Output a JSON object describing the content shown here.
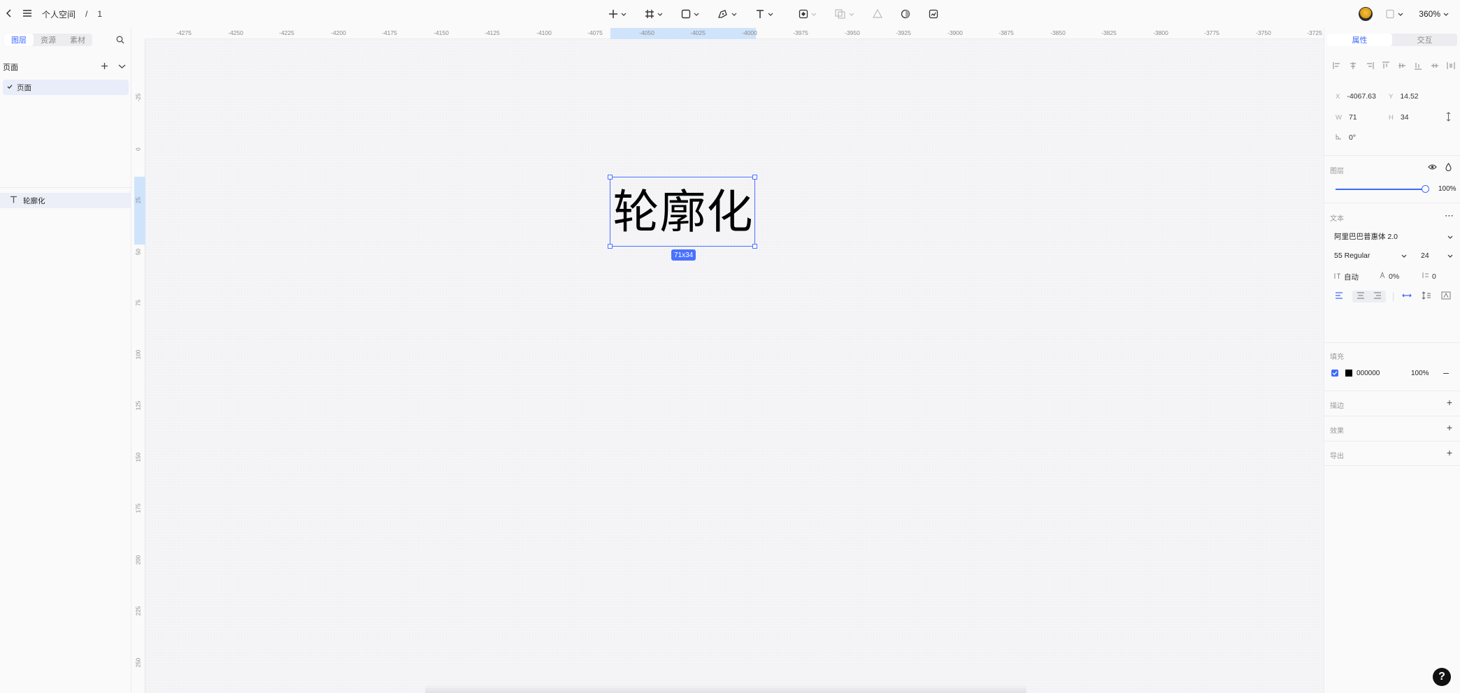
{
  "topbar": {
    "breadcrumb_space": "个人空间",
    "breadcrumb_sep": "/",
    "breadcrumb_file": "1",
    "zoom": "360%"
  },
  "left_panel": {
    "tabs": [
      "图层",
      "资源",
      "素材"
    ],
    "active_tab": "图层",
    "pages_title": "页面",
    "pages": [
      {
        "label": "页面",
        "selected": true
      }
    ],
    "layers": [
      {
        "label": "轮廓化",
        "type": "text-icon"
      }
    ]
  },
  "rulers": {
    "h_ticks": [
      "-4275",
      "-4250",
      "-4225",
      "-4200",
      "-4175",
      "-4150",
      "-4125",
      "-4100",
      "-4075",
      "-4050",
      "-4025",
      "-4000",
      "-3975",
      "-3950",
      "-3925",
      "-3900",
      "-3875",
      "-3850",
      "-3825",
      "-3800",
      "-3775",
      "-3750",
      "-3725"
    ],
    "v_ticks": [
      "-25",
      "0",
      "25",
      "50",
      "75",
      "100",
      "125",
      "150",
      "175",
      "200",
      "225",
      "250"
    ]
  },
  "canvas": {
    "text_content": "轮廓化",
    "size_badge": "71x34"
  },
  "right_panel": {
    "tabs": [
      "属性",
      "交互"
    ],
    "active_tab": "属性",
    "x_label": "X",
    "x_value": "-4067.63",
    "y_label": "Y",
    "y_value": "14.52",
    "w_label": "W",
    "w_value": "71",
    "h_label": "H",
    "h_value": "34",
    "rotation": "0°",
    "layer_title": "图层",
    "opacity": "100%",
    "opacity_fraction": 1.0,
    "text_title": "文本",
    "font_family": "阿里巴巴普惠体 2.0",
    "font_weight": "55 Regular",
    "font_size": "24",
    "line_height": "自动",
    "letter_spacing": "0%",
    "paragraph_spacing": "0",
    "fill_title": "填充",
    "fill_hex": "000000",
    "fill_color": "#000000",
    "fill_opacity": "100%",
    "stroke_title": "描边",
    "effect_title": "效果",
    "export_title": "导出"
  },
  "colors": {
    "accent": "#3d6aff",
    "selection": "#4a72ff"
  }
}
